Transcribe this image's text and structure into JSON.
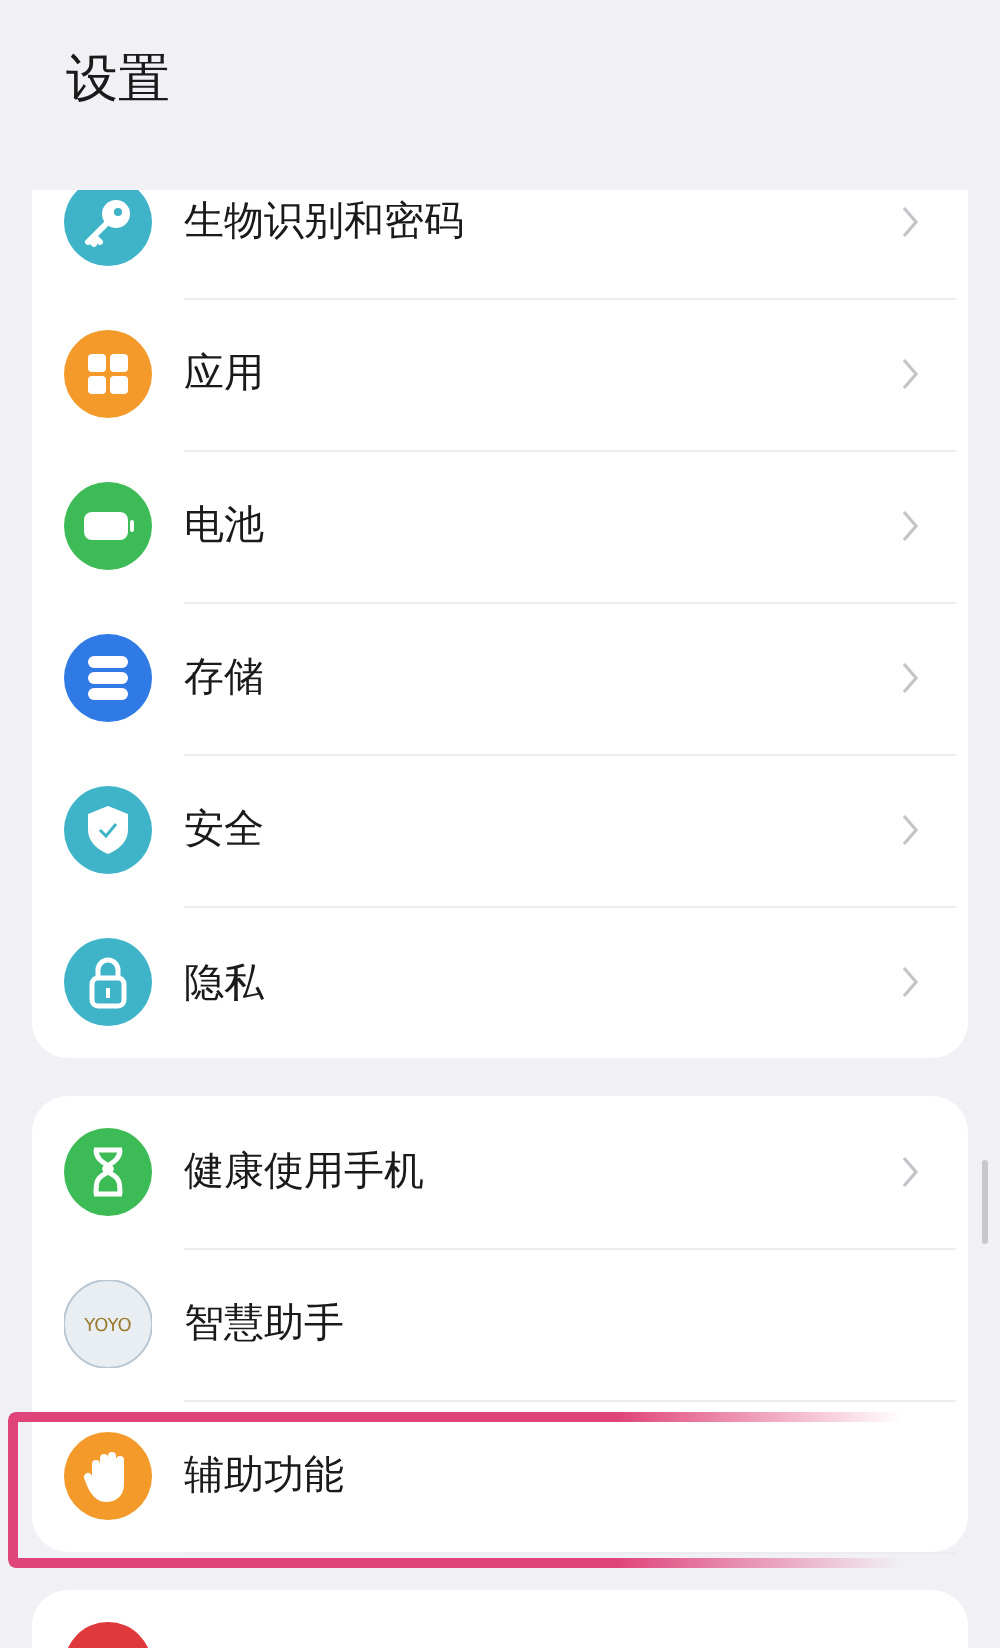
{
  "header": {
    "title": "设置"
  },
  "groups": [
    {
      "items": [
        {
          "label": "生物识别和密码",
          "color": "#3fb3c8",
          "chevron": true
        },
        {
          "label": "应用",
          "color": "#f39a2b",
          "chevron": true
        },
        {
          "label": "电池",
          "color": "#3dbb56",
          "chevron": true
        },
        {
          "label": "存储",
          "color": "#2f7ae5",
          "chevron": true
        },
        {
          "label": "安全",
          "color": "#3fb3c8",
          "chevron": true
        },
        {
          "label": "隐私",
          "color": "#3fb3c8",
          "chevron": true
        }
      ]
    },
    {
      "items": [
        {
          "label": "健康使用手机",
          "color": "#3dbb56",
          "chevron": true
        },
        {
          "label": "智慧助手",
          "color": "#e8eef2",
          "badge": "YOYO"
        },
        {
          "label": "辅助功能",
          "color": "#f39a2b",
          "highlighted": true
        }
      ]
    },
    {
      "items": [
        {
          "color": "#e0393b"
        }
      ]
    }
  ]
}
